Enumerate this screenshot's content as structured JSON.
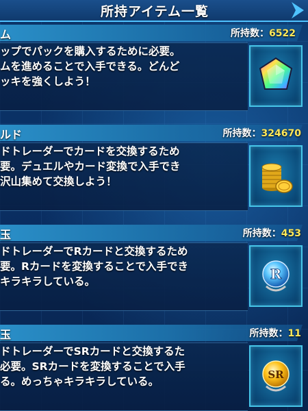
{
  "screen": {
    "title": "所持アイテム一覧"
  },
  "items": [
    {
      "name": "ム",
      "count_label": "所持数：",
      "count_value": "6522",
      "description": "ップでパックを購入するために必要。\nムを進めることで入手できる。どんど\nッキを強くしよう！",
      "icon": "rainbow-gem-icon"
    },
    {
      "name": "ルド",
      "count_label": "所持数：",
      "count_value": "324670",
      "description": "ドトレーダーでカードを交換するため\n要。デュエルやカード変換で入手でき\n沢山集めて交換しよう！",
      "icon": "gold-coins-icon"
    },
    {
      "name": "玉",
      "count_label": "所持数：",
      "count_value": "453",
      "description": "ドトレーダーでRカードと交換するため\n要。Rカードを変換することで入手でき\nキラキラしている。",
      "icon": "r-orb-icon"
    },
    {
      "name": "玉",
      "count_label": "所持数：",
      "count_value": "11",
      "description": "ドトレーダーでSRカードと交換するた\n必要。SRカードを変換することで入手\nる。めっちゃキラキラしている。",
      "icon": "sr-orb-icon"
    }
  ],
  "colors": {
    "count_value": "#ffe85a",
    "header_bar": "#2a8fc8",
    "frame_border": "#47c6e8"
  }
}
